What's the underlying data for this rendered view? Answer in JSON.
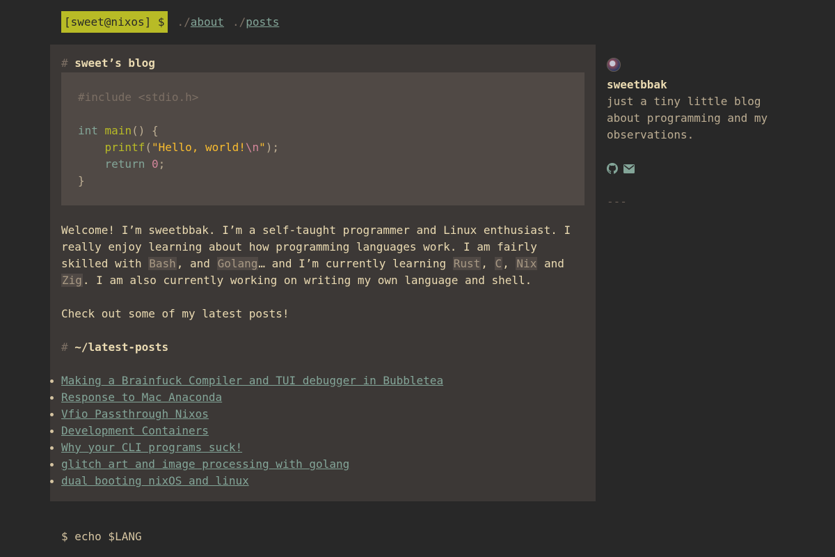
{
  "nav": {
    "prompt": "[sweet@nixos] $",
    "links": [
      {
        "prefix": "./",
        "label": "about"
      },
      {
        "prefix": "./",
        "label": "posts"
      }
    ]
  },
  "main": {
    "title_hash": "#",
    "title": "sweet’s blog",
    "code_lines": [
      "#include <stdio.h>",
      "",
      "int main() {",
      "    printf(\"Hello, world!\\n\");",
      "    return 0;",
      "}"
    ],
    "intro": {
      "part1": "Welcome! I’m sweetbbak. I’m a self-taught programmer and Linux enthusiast. I really enjoy learning about how programming languages work. I am fairly skilled with ",
      "bash": "Bash",
      "part2": ", and ",
      "golang": "Golang",
      "part3": "… and I’m currently learning ",
      "rust": "Rust",
      "sep1": ", ",
      "c": "C",
      "sep2": ", ",
      "nix": "Nix",
      "part4": " and ",
      "zig": "Zig",
      "part5": ". I am also currently working on writing my own language and shell."
    },
    "check_out": "Check out some of my latest posts!",
    "latest_hash": "#",
    "latest_title": "~/latest-posts",
    "posts": [
      "Making a Brainfuck Compiler and TUI debugger in Bubbletea",
      "Response to Mac Anaconda",
      "Vfio Passthrough Nixos",
      "Development Containers",
      "Why your CLI programs suck!",
      "glitch art and image processing with golang",
      "dual booting nixOS and linux"
    ]
  },
  "sidebar": {
    "username": "sweetbbak",
    "bio": "just a tiny little blog about programming and my observations.",
    "icons": [
      "github-icon",
      "mail-icon"
    ],
    "divider": "---"
  },
  "footer": {
    "text": "$ echo $LANG"
  },
  "colors": {
    "background": "#282828",
    "panel": "#3c3836",
    "code_bg": "#504945",
    "accent": "#b8bb26",
    "link": "#83a598"
  }
}
